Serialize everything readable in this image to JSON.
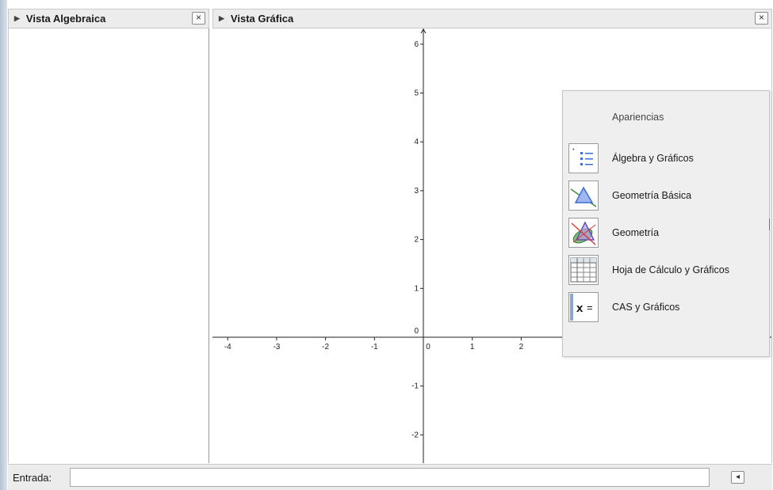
{
  "algebra_view": {
    "title": "Vista Algebraica",
    "close_icon": "close-icon",
    "expand_icon": "triangle-right-icon"
  },
  "graphics_view": {
    "title": "Vista Gráfica",
    "close_icon": "close-icon",
    "expand_icon": "triangle-right-icon",
    "x_ticks": [
      "-4",
      "-3",
      "-2",
      "-1",
      "0",
      "1",
      "2"
    ],
    "y_ticks": [
      "6",
      "5",
      "4",
      "3",
      "2",
      "1",
      "0",
      "-1",
      "-2"
    ]
  },
  "perspectives": {
    "title": "Apariencias",
    "items": [
      {
        "label": "Álgebra y Gráficos",
        "icon": "algebra-graphics-icon"
      },
      {
        "label": "Geometría Básica",
        "icon": "basic-geometry-icon"
      },
      {
        "label": "Geometría",
        "icon": "geometry-icon"
      },
      {
        "label": "Hoja de Cálculo y Gráficos",
        "icon": "spreadsheet-icon"
      },
      {
        "label": "CAS y Gráficos",
        "icon": "cas-icon"
      }
    ]
  },
  "input_bar": {
    "label": "Entrada:",
    "value": "",
    "help_icon": "input-help-icon"
  },
  "colors": {
    "panel_header": "#ececec",
    "border": "#c9c9c9",
    "icon_blue": "#3b6fd6"
  }
}
